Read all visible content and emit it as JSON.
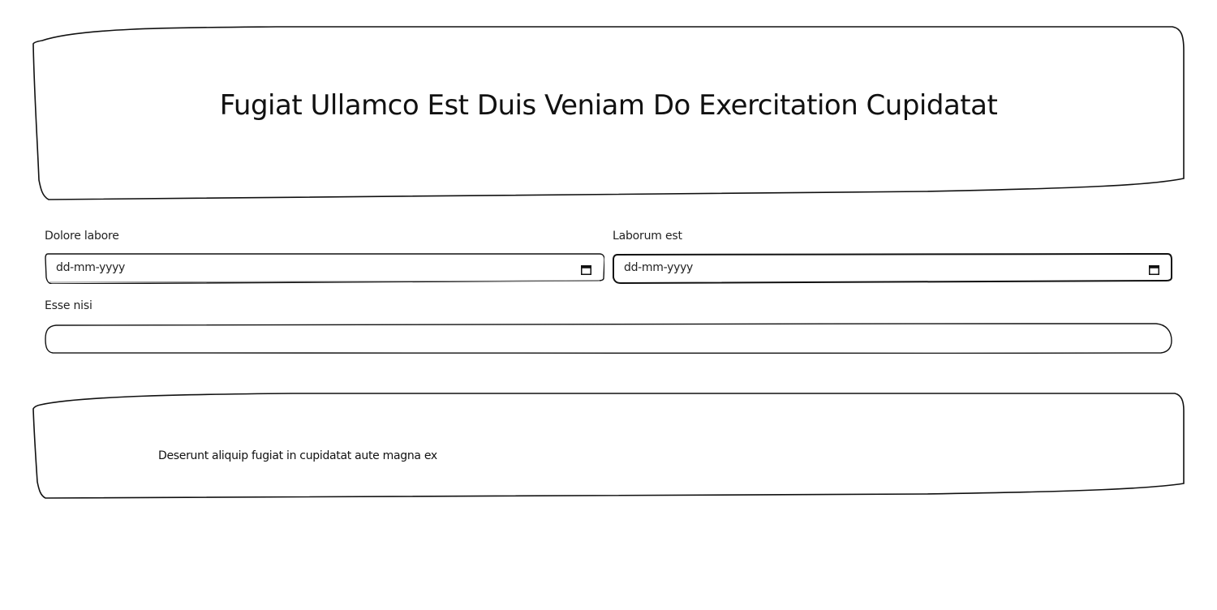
{
  "header": {
    "title": "Fugiat Ullamco Est Duis Veniam Do Exercitation Cupidatat"
  },
  "form": {
    "field1": {
      "label": "Dolore labore",
      "placeholder": "dd-mm-yyyy",
      "icon": "calendar-icon"
    },
    "field2": {
      "label": "Laborum est",
      "placeholder": "dd-mm-yyyy",
      "icon": "calendar-icon"
    },
    "field3": {
      "label": "Esse nisi",
      "value": ""
    }
  },
  "info": {
    "text": "Deserunt aliquip fugiat in cupidatat aute magna ex"
  }
}
